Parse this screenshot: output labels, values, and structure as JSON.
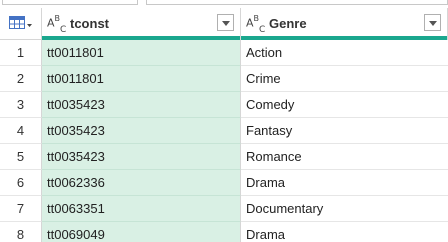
{
  "columns": [
    {
      "type_label": "ABC",
      "title": "tconst"
    },
    {
      "type_label": "ABC",
      "title": "Genre"
    }
  ],
  "rows": [
    {
      "n": "1",
      "tconst": "tt0011801",
      "genre": "Action"
    },
    {
      "n": "2",
      "tconst": "tt0011801",
      "genre": "Crime"
    },
    {
      "n": "3",
      "tconst": "tt0035423",
      "genre": "Comedy"
    },
    {
      "n": "4",
      "tconst": "tt0035423",
      "genre": "Fantasy"
    },
    {
      "n": "5",
      "tconst": "tt0035423",
      "genre": "Romance"
    },
    {
      "n": "6",
      "tconst": "tt0062336",
      "genre": "Drama"
    },
    {
      "n": "7",
      "tconst": "tt0063351",
      "genre": "Documentary"
    },
    {
      "n": "8",
      "tconst": "tt0069049",
      "genre": "Drama"
    }
  ],
  "colors": {
    "accent": "#1aa78e",
    "selected_column": "#d9f0e4"
  }
}
